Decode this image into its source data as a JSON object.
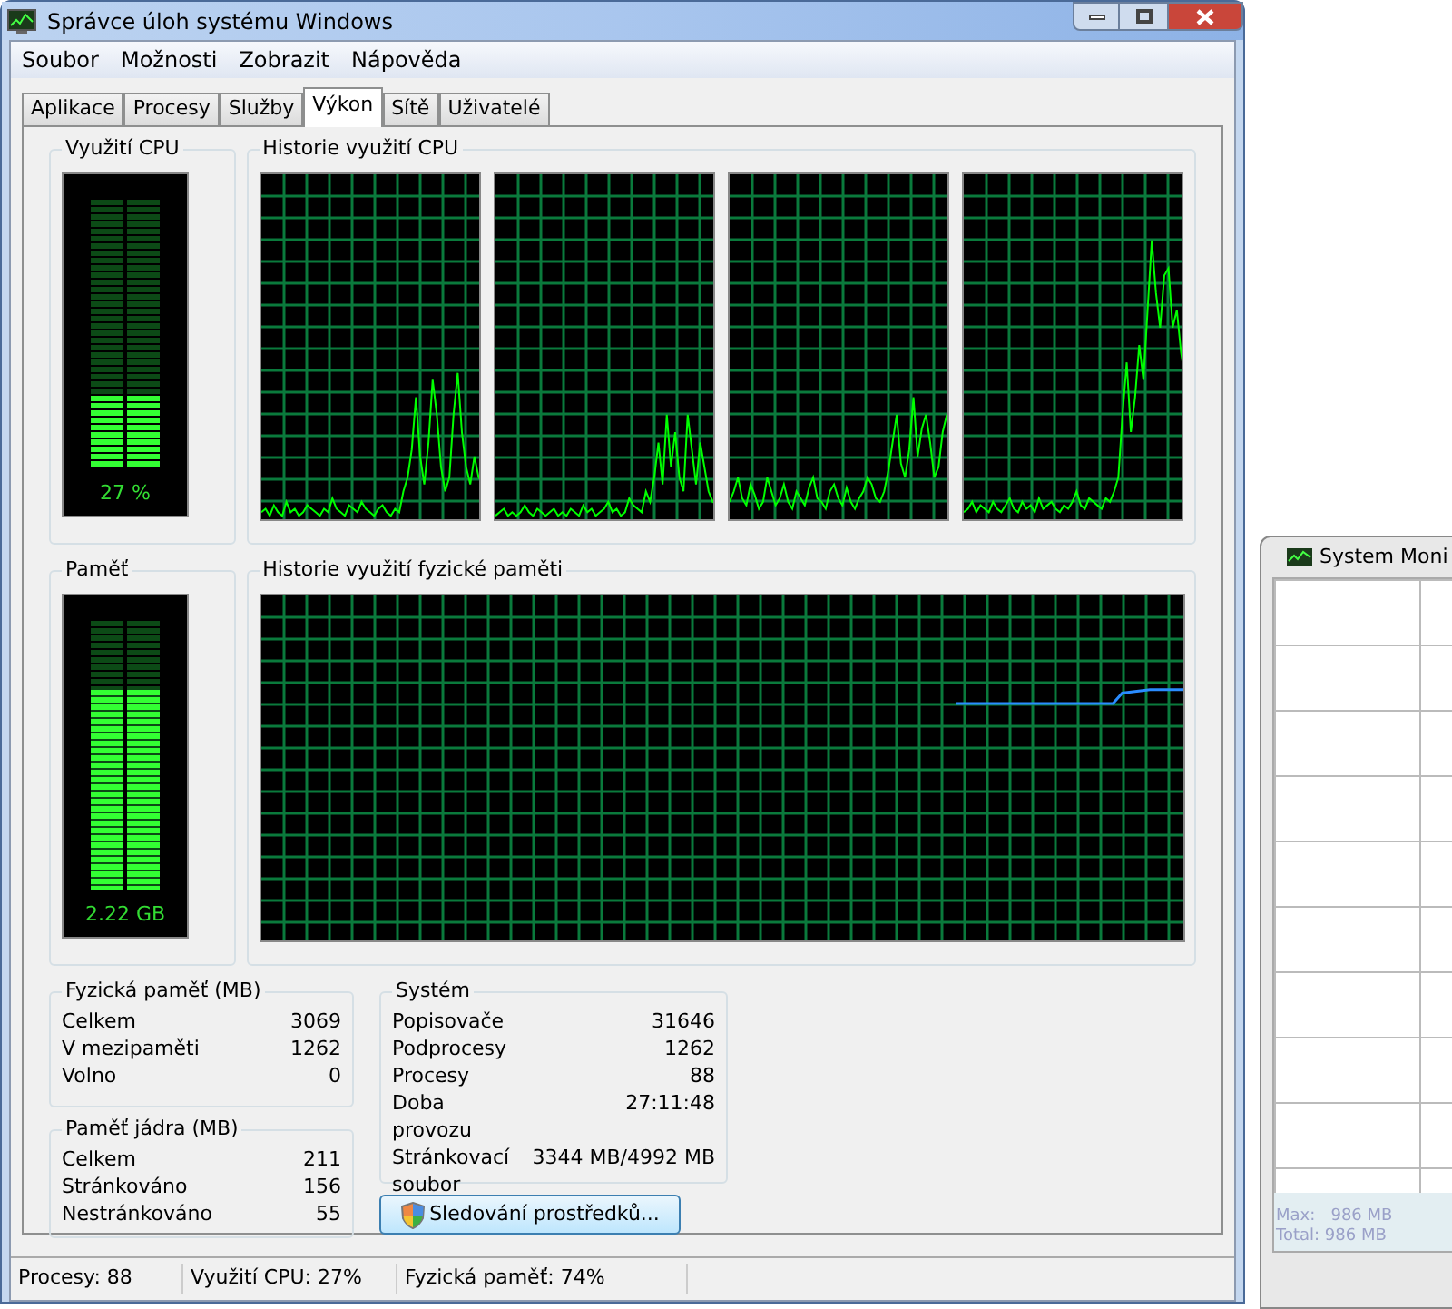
{
  "window": {
    "title": "Správce úloh systému Windows"
  },
  "menu": [
    "Soubor",
    "Možnosti",
    "Zobrazit",
    "Nápověda"
  ],
  "tabs": [
    {
      "label": "Aplikace",
      "selected": false
    },
    {
      "label": "Procesy",
      "selected": false
    },
    {
      "label": "Služby",
      "selected": false
    },
    {
      "label": "Výkon",
      "selected": true
    },
    {
      "label": "Sítě",
      "selected": false
    },
    {
      "label": "Uživatelé",
      "selected": false
    }
  ],
  "cpu_usage": {
    "title": "Využití CPU",
    "level": 0.27,
    "reading": "27 %"
  },
  "cpu_history": {
    "title": "Historie využití CPU"
  },
  "memory": {
    "title": "Paměť",
    "level": 0.74,
    "reading": "2.22 GB"
  },
  "memory_history": {
    "title": "Historie využití fyzické paměti"
  },
  "physical_memory": {
    "title": "Fyzická paměť (MB)",
    "rows": [
      {
        "label": "Celkem",
        "value": "3069"
      },
      {
        "label": "V mezipaměti",
        "value": "1262"
      },
      {
        "label": "Volno",
        "value": "0"
      }
    ]
  },
  "kernel_memory": {
    "title": "Paměť jádra (MB)",
    "rows": [
      {
        "label": "Celkem",
        "value": "211"
      },
      {
        "label": "Stránkováno",
        "value": "156"
      },
      {
        "label": "Nestránkováno",
        "value": "55"
      }
    ]
  },
  "system": {
    "title": "Systém",
    "rows": [
      {
        "label": "Popisovače",
        "value": "31646"
      },
      {
        "label": "Podprocesy",
        "value": "1262"
      },
      {
        "label": "Procesy",
        "value": "88"
      },
      {
        "label": "Doba provozu",
        "value": "27:11:48"
      },
      {
        "label": "Stránkovací soubor",
        "value": "3344 MB/4992 MB"
      }
    ]
  },
  "resource_monitor_button": "Sledování prostředků...",
  "status_bar": [
    "Procesy: 88",
    "Využití CPU: 27%",
    "Fyzická paměť: 74%"
  ],
  "background_window": {
    "title": "System Moni",
    "max": "Max:   986 MB",
    "total": "Total: 986 MB"
  }
}
